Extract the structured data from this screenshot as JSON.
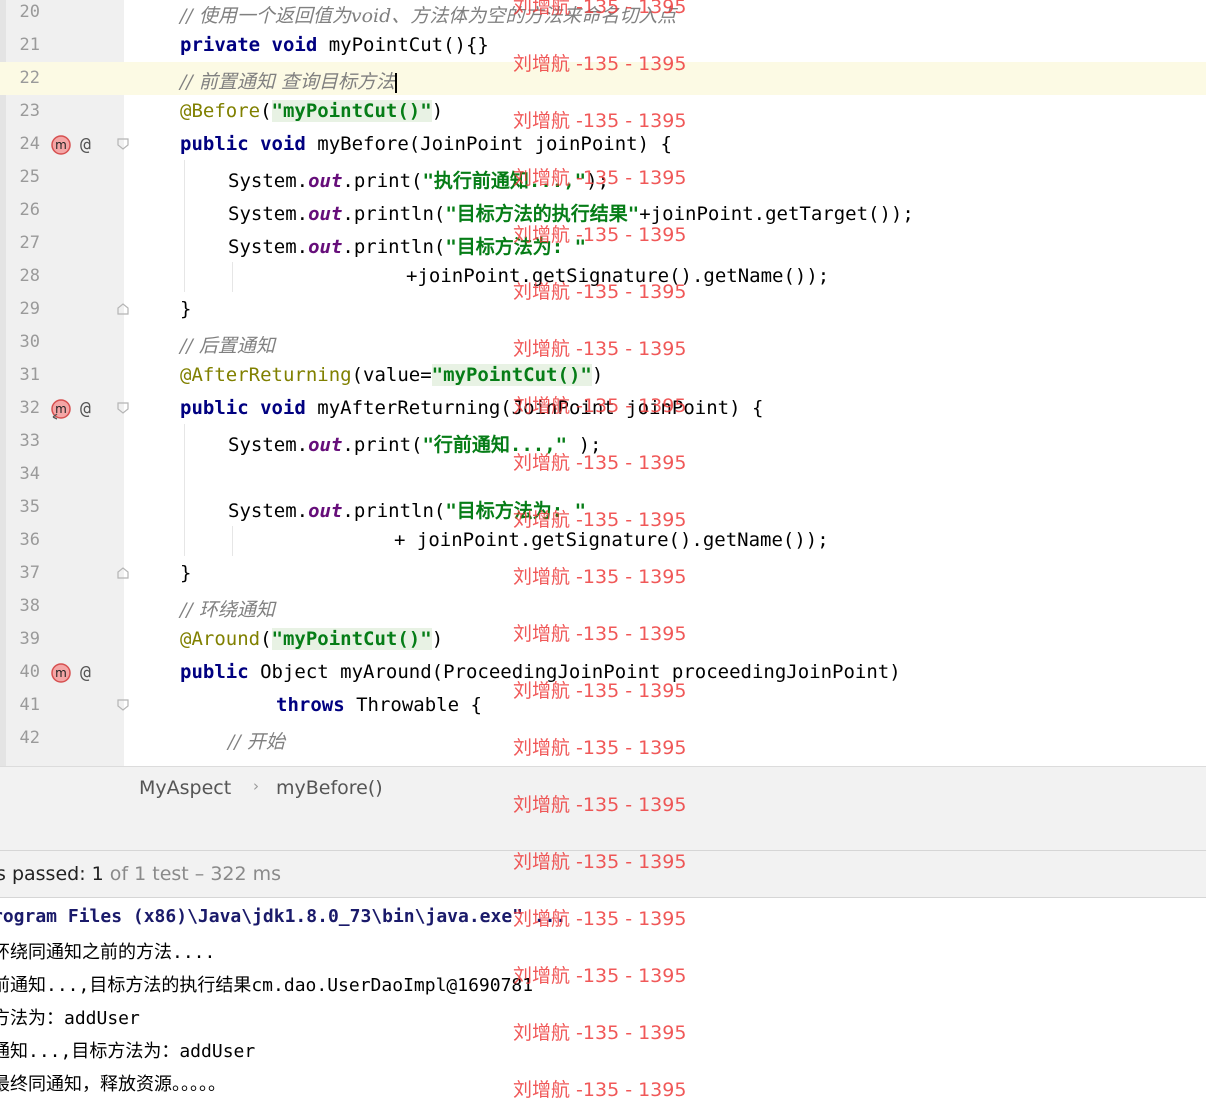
{
  "editor": {
    "lines": [
      {
        "no": "20",
        "code": "// 使用一个返回值为void、方法体为空的方法来命名切入点"
      },
      {
        "no": "21",
        "code": "private void myPointCut(){}"
      },
      {
        "no": "22",
        "code": "// 前置通知 查询目标方法"
      },
      {
        "no": "23",
        "code": "@Before(\"myPointCut()\")"
      },
      {
        "no": "24",
        "code": "public void myBefore(JoinPoint joinPoint) {"
      },
      {
        "no": "25",
        "code": "System.out.print(\"执行前通知...,\");"
      },
      {
        "no": "26",
        "code": "System.out.println(\"目标方法的执行结果\"+joinPoint.getTarget());"
      },
      {
        "no": "27",
        "code": "System.out.println(\"目标方法为: \""
      },
      {
        "no": "28",
        "code": "+joinPoint.getSignature().getName());"
      },
      {
        "no": "29",
        "code": "}"
      },
      {
        "no": "30",
        "code": "// 后置通知"
      },
      {
        "no": "31",
        "code": "@AfterReturning(value=\"myPointCut()\")"
      },
      {
        "no": "32",
        "code": "public void myAfterReturning(JoinPoint joinPoint) {"
      },
      {
        "no": "33",
        "code": "System.out.print(\"行前通知...,\" );"
      },
      {
        "no": "34",
        "code": ""
      },
      {
        "no": "35",
        "code": "System.out.println(\"目标方法为: \""
      },
      {
        "no": "36",
        "code": "+ joinPoint.getSignature().getName());"
      },
      {
        "no": "37",
        "code": "}"
      },
      {
        "no": "38",
        "code": "// 环绕通知"
      },
      {
        "no": "39",
        "code": "@Around(\"myPointCut()\")"
      },
      {
        "no": "40",
        "code": "public Object myAround(ProceedingJoinPoint proceedingJoinPoint)"
      },
      {
        "no": "41",
        "code": "throws Throwable {"
      },
      {
        "no": "42",
        "code": "// 开始"
      }
    ],
    "current_line": "22",
    "gutter_icons": {
      "method": "m-icon",
      "annotation": "@"
    }
  },
  "breadcrumb": {
    "items": [
      "MyAspect",
      "myBefore()"
    ],
    "separator": "›"
  },
  "test_status": {
    "prefix": "s passed: ",
    "passed": "1",
    "of_text": " of 1 test",
    "duration": " – 322 ms"
  },
  "console": {
    "lines": [
      "rogram Files (x86)\\Java\\jdk1.8.0_73\\bin\\java.exe\" ...",
      "环绕同通知之前的方法....",
      "前通知...,目标方法的执行结果cm.dao.UserDaoImpl@1690781",
      "方法为：addUser",
      "通知...,目标方法为：addUser",
      "最终同通知，释放资源。。。。。"
    ]
  },
  "watermark": {
    "text": "刘增航 -135 - 1395"
  },
  "colors": {
    "keyword": "#000080",
    "string": "#067d17",
    "annotation": "#808000",
    "comment": "#808080",
    "field": "#660e7a",
    "watermark": "#ee3b3b",
    "current_line": "#fcfae4"
  }
}
